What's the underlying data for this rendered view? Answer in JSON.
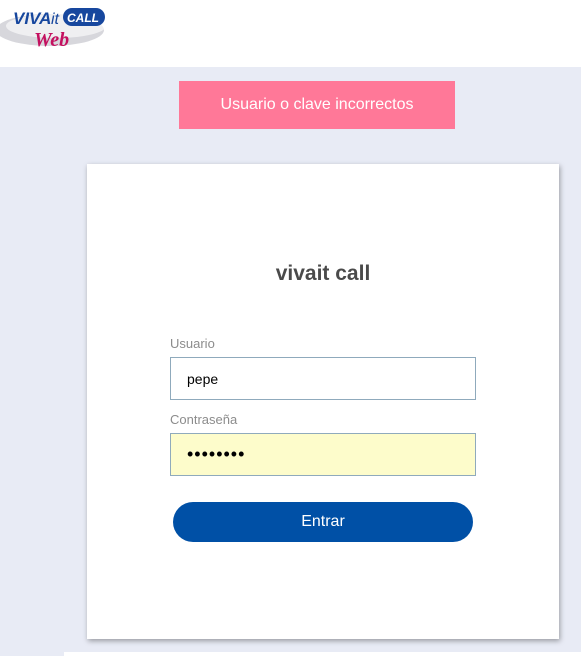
{
  "logo": {
    "brand_main": "VIVA",
    "brand_it": "it",
    "brand_call": "CALL",
    "brand_web": "Web"
  },
  "alert": {
    "message": "Usuario o clave incorrectos",
    "color": "#ff7898"
  },
  "login": {
    "title": "vivait call",
    "user_label": "Usuario",
    "user_value": "pepe",
    "password_label": "Contraseña",
    "password_masked": "••••••••",
    "submit_label": "Entrar"
  },
  "colors": {
    "background": "#e8ebf5",
    "button": "#0050a6",
    "password_field": "#fdfccb"
  }
}
